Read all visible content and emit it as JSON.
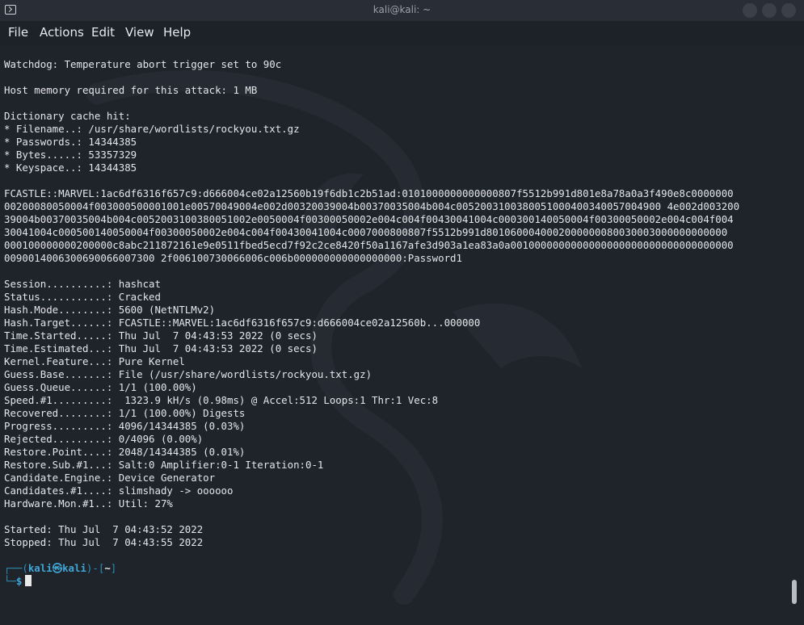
{
  "window": {
    "title": "kali@kali: ~",
    "app_icon": "terminal-icon"
  },
  "menu": {
    "file": "File",
    "actions": "Actions",
    "edit": "Edit",
    "view": "View",
    "help": "Help"
  },
  "terminal": {
    "lines": [
      "Watchdog: Temperature abort trigger set to 90c",
      "",
      "Host memory required for this attack: 1 MB",
      "",
      "Dictionary cache hit:",
      "* Filename..: /usr/share/wordlists/rockyou.txt.gz",
      "* Passwords.: 14344385",
      "* Bytes.....: 53357329",
      "* Keyspace..: 14344385",
      "",
      "FCASTLE::MARVEL:1ac6df6316f657c9:d666004ce02a12560b19f6db1c2b51ad:0101000000000000807f5512b991d801e8a78a0a3f490e8c0000000",
      "00200080050004f003000500001001e00570049004e002d00320039004b00370035004b004c0052003100380051000400340057004900 4e002d003200",
      "39004b00370035004b004c0052003100380051002e0050004f00300050002e004c004f00430041004c000300140050004f00300050002e004c004f004",
      "30041004c000500140050004f00300050002e004c004f00430041004c0007000800807f5512b991d8010600040002000000080030003000000000000",
      "000100000000200000c8abc211872161e9e0511fbed5ecd7f92c2ce8420f50a1167afe3d903a1ea83a0a0010000000000000000000000000000000000",
      "0090014006300690066007300 2f006100730066006c006b000000000000000000:Password1",
      "",
      "Session..........: hashcat",
      "Status...........: Cracked",
      "Hash.Mode........: 5600 (NetNTLMv2)",
      "Hash.Target......: FCASTLE::MARVEL:1ac6df6316f657c9:d666004ce02a12560b...000000",
      "Time.Started.....: Thu Jul  7 04:43:53 2022 (0 secs)",
      "Time.Estimated...: Thu Jul  7 04:43:53 2022 (0 secs)",
      "Kernel.Feature...: Pure Kernel",
      "Guess.Base.......: File (/usr/share/wordlists/rockyou.txt.gz)",
      "Guess.Queue......: 1/1 (100.00%)",
      "Speed.#1.........:  1323.9 kH/s (0.98ms) @ Accel:512 Loops:1 Thr:1 Vec:8",
      "Recovered........: 1/1 (100.00%) Digests",
      "Progress.........: 4096/14344385 (0.03%)",
      "Rejected.........: 0/4096 (0.00%)",
      "Restore.Point....: 2048/14344385 (0.01%)",
      "Restore.Sub.#1...: Salt:0 Amplifier:0-1 Iteration:0-1",
      "Candidate.Engine.: Device Generator",
      "Candidates.#1....: slimshady -> oooooo",
      "Hardware.Mon.#1..: Util: 27%",
      "",
      "Started: Thu Jul  7 04:43:52 2022",
      "Stopped: Thu Jul  7 04:43:55 2022",
      ""
    ],
    "prompt": {
      "top_left": "┌──(",
      "user": "kali",
      "at_symbol": "㉿",
      "host": "kali",
      "middle": ")-[",
      "dir": "~",
      "end": "]",
      "bottom_left": "└─",
      "symbol": "$"
    }
  },
  "colors": {
    "background": "#1f232a",
    "text": "#e4e6e9",
    "prompt_user": "#3fa6d6",
    "prompt_frame": "#2f8fb5"
  }
}
